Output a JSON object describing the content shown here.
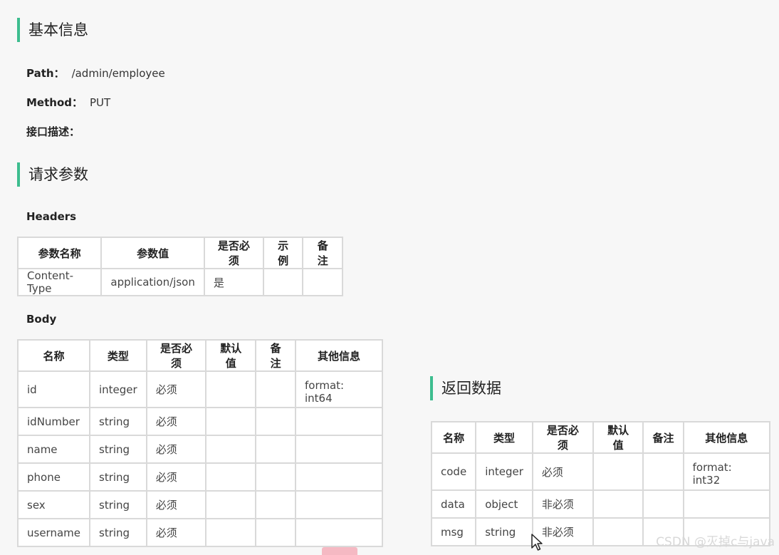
{
  "basic_info": {
    "title": "基本信息",
    "path_label": "Path：",
    "path_value": "/admin/employee",
    "method_label": "Method：",
    "method_value": "PUT",
    "desc_label": "接口描述："
  },
  "request_params": {
    "title": "请求参数",
    "headers_title": "Headers",
    "headers_columns": [
      "参数名称",
      "参数值",
      "是否必须",
      "示例",
      "备注"
    ],
    "headers_rows": [
      [
        "Content-Type",
        "application/json",
        "是",
        "",
        ""
      ]
    ],
    "body_title": "Body",
    "body_columns": [
      "名称",
      "类型",
      "是否必须",
      "默认值",
      "备注",
      "其他信息"
    ],
    "body_rows": [
      [
        "id",
        "integer",
        "必须",
        "",
        "",
        "format: int64"
      ],
      [
        "idNumber",
        "string",
        "必须",
        "",
        "",
        ""
      ],
      [
        "name",
        "string",
        "必须",
        "",
        "",
        ""
      ],
      [
        "phone",
        "string",
        "必须",
        "",
        "",
        ""
      ],
      [
        "sex",
        "string",
        "必须",
        "",
        "",
        ""
      ],
      [
        "username",
        "string",
        "必须",
        "",
        "",
        ""
      ]
    ]
  },
  "response": {
    "title": "返回数据",
    "columns": [
      "名称",
      "类型",
      "是否必须",
      "默认值",
      "备注",
      "其他信息"
    ],
    "rows": [
      [
        "code",
        "integer",
        "必须",
        "",
        "",
        "format: int32"
      ],
      [
        "data",
        "object",
        "非必须",
        "",
        "",
        ""
      ],
      [
        "msg",
        "string",
        "非必须",
        "",
        "",
        ""
      ]
    ]
  },
  "watermark": "CSDN @灭掉c与java"
}
